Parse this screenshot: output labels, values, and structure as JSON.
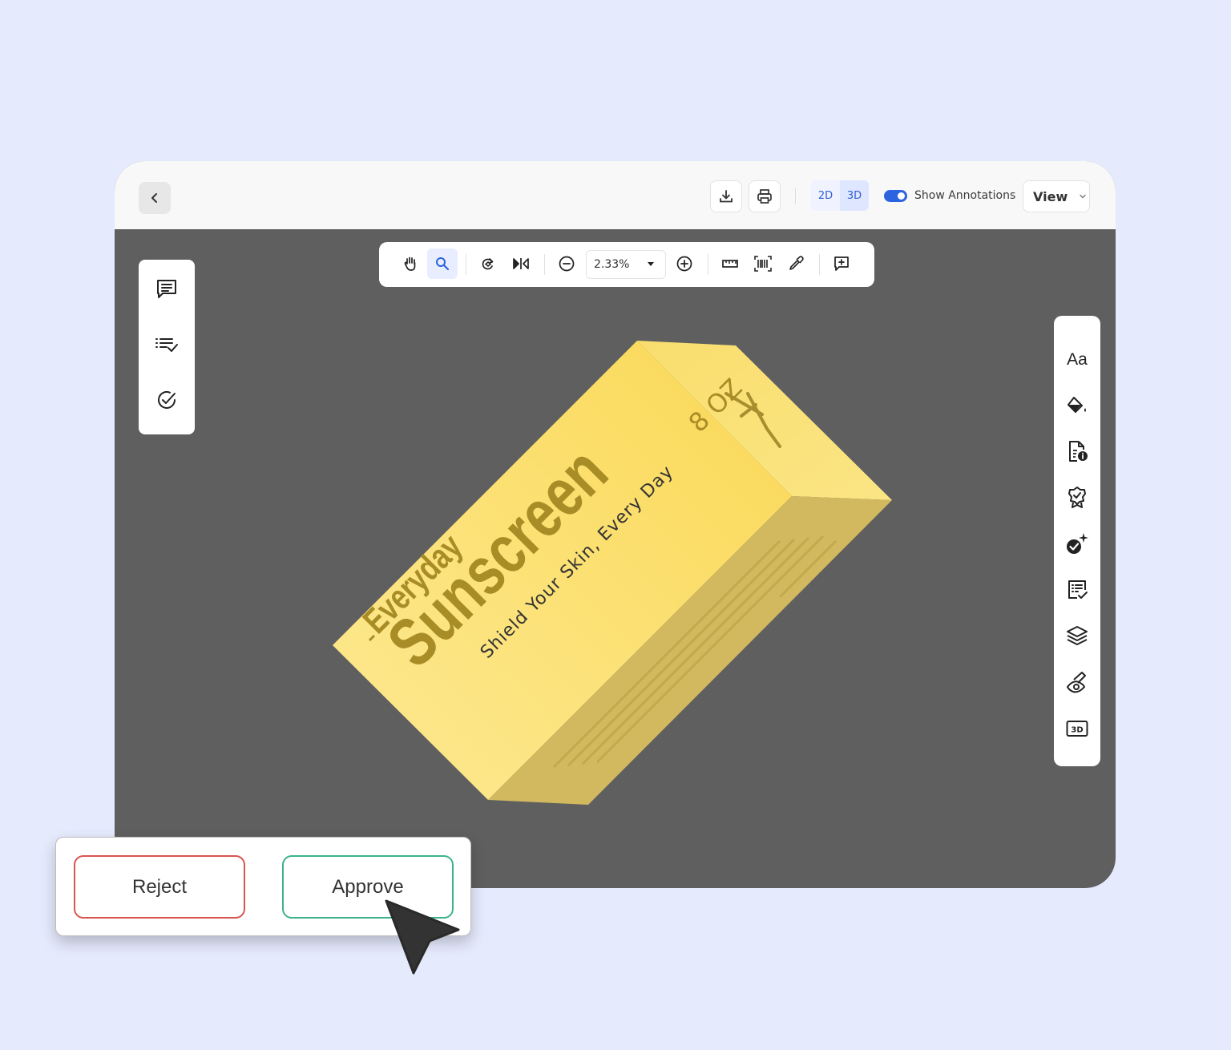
{
  "toolbar": {
    "mode_2d": "2D",
    "mode_3d": "3D",
    "show_annotations_label": "Show Annotations",
    "show_annotations_on": true,
    "view_label": "View"
  },
  "view_tools": {
    "zoom_value": "2.33%"
  },
  "right_panel": {
    "text_tool_label": "Aa",
    "badge_3d": "3D"
  },
  "package": {
    "line1": "Everyday",
    "line2": "Sunscreen",
    "tagline": "Shield Your Skin, Every Day",
    "size": "8 OZ",
    "colors": {
      "front": "#fbe27a",
      "top": "#f5d75e",
      "side": "#d2b95f"
    }
  },
  "decision": {
    "reject_label": "Reject",
    "approve_label": "Approve"
  },
  "colors": {
    "background": "#e5eafd",
    "canvas": "#5f5f5f",
    "accent": "#2c64e0",
    "reject": "#d9544f",
    "approve": "#3db38a"
  }
}
